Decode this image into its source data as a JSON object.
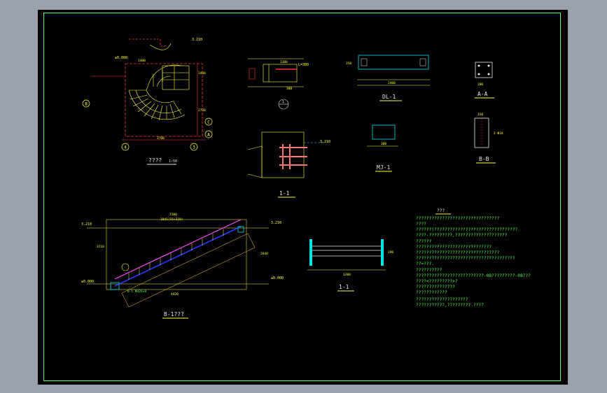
{
  "app": {
    "background_color": "#9aa2ad",
    "canvas_color": "#000000",
    "frame_color": "#5fff6a"
  },
  "plan": {
    "title": "????",
    "scale": "1:50",
    "elev_top": "3.210",
    "elev_bottom": "±0.000",
    "axis_b": "B",
    "axis_c": "C",
    "axis_a": "A",
    "axis_4": "4",
    "axis_3": "3",
    "dim_width": "3700",
    "dim_height": "3400",
    "dim_side": "1400",
    "dim_stair": "2720"
  },
  "detail_top": {
    "label_l": "L=300",
    "dim_a": "1300",
    "dim_b": "300",
    "circle_label": "1"
  },
  "dl1": {
    "title": "DL-1",
    "dim_w": "2400",
    "dim_h": "350"
  },
  "aa": {
    "title": "A-A",
    "dim_w": "200"
  },
  "detail_mid": {
    "title": "1-1",
    "elev": "3.210"
  },
  "mj1": {
    "title": "MJ-1",
    "dim_w": "300"
  },
  "bb": {
    "title": "B-B",
    "dim_w": "150",
    "rebar": "2-Φ18"
  },
  "elevation": {
    "title": "B-1???",
    "elev_top_l": "3.210",
    "elev_top_r": "3.210",
    "elev_bot_l": "±0.000",
    "elev_bot_r": "±0.000",
    "dim_total": "7200",
    "dim_top": "1845(15×328)",
    "dim_bot": "4420",
    "dim_h": "3210",
    "dim_right": "2640",
    "note": "B-1 Φ426×8"
  },
  "section11": {
    "title": "1-1",
    "dim_w": "1200",
    "dim_h": "290"
  },
  "notes": {
    "heading": "???",
    "lines": [
      "????????????????????????????????",
      "????",
      " ??????(????????????????????????????????",
      " ????-?????????,????????????????????",
      "??????",
      " ?????????????????????????????",
      " ????????????????????????????????",
      "  ??????????????????????????????????????",
      " ??=???.",
      "??????????",
      " ??????????????????????????-08?????????-08???",
      " ????<?????????>?",
      " ???????????????",
      " ????????????",
      "????????????????????",
      "???????????,?????????.????"
    ]
  }
}
